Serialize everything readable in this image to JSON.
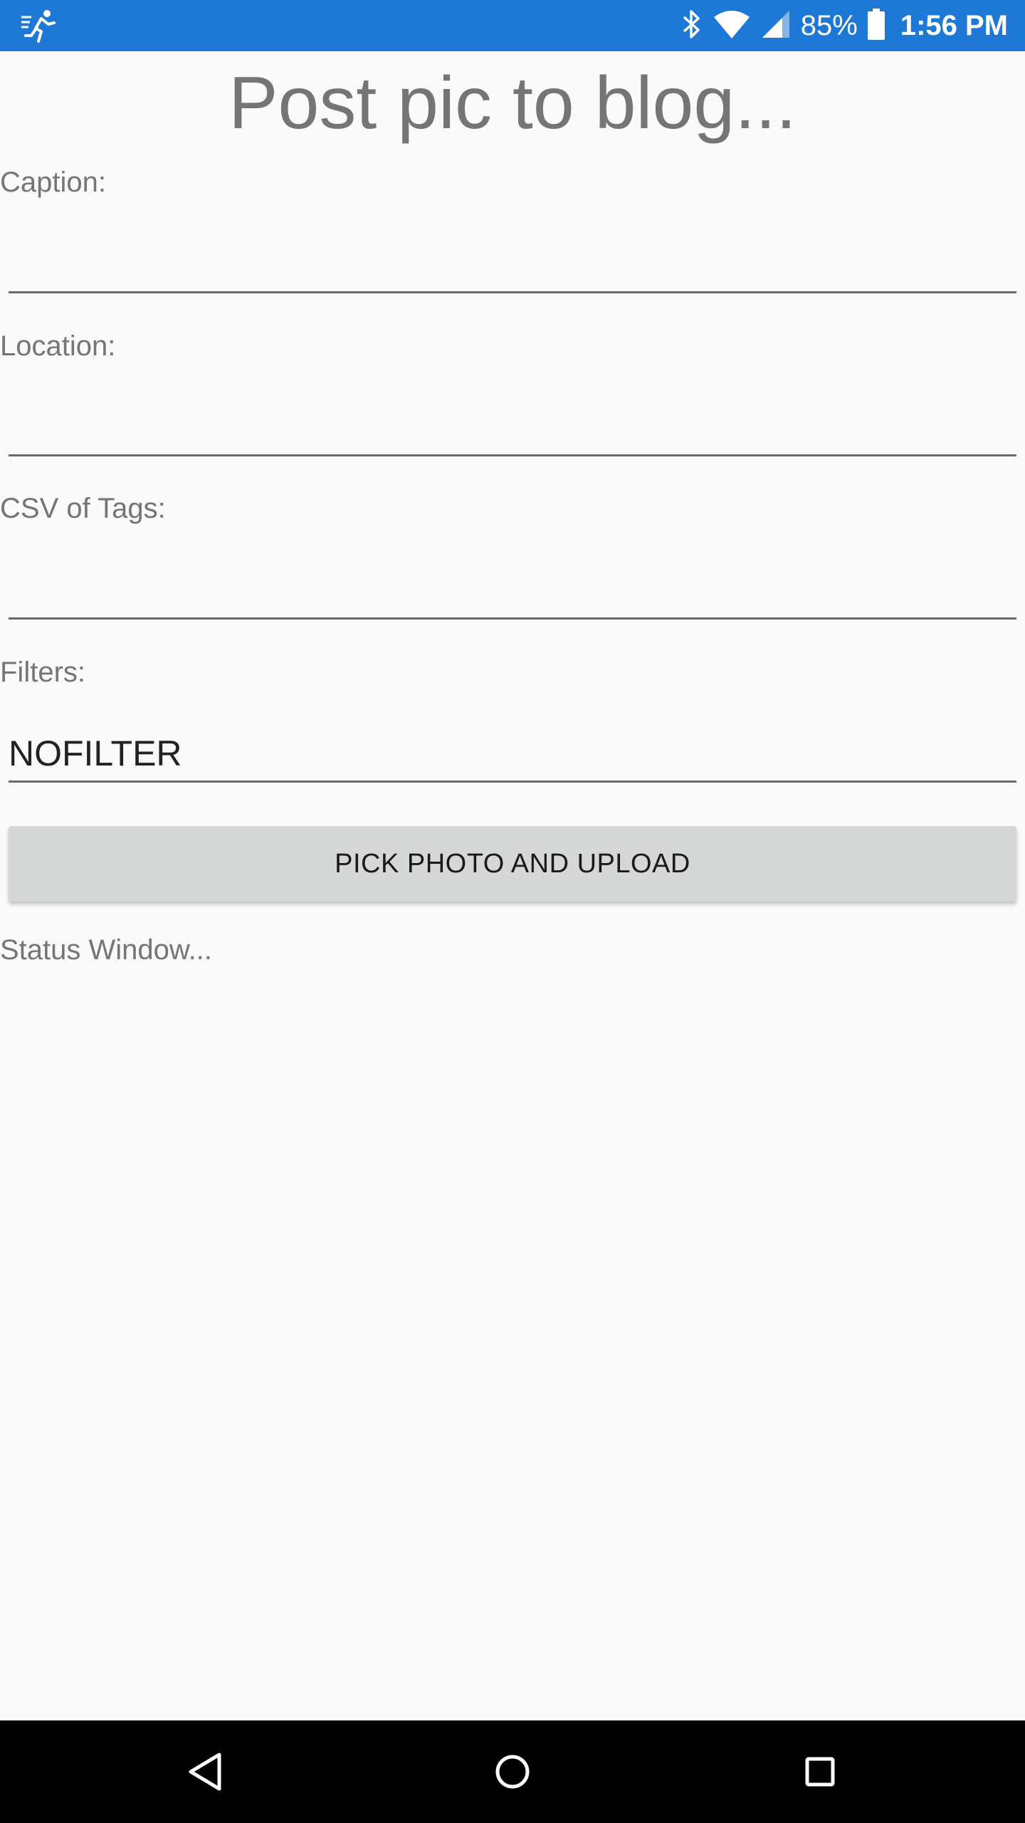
{
  "status_bar": {
    "battery_percent": "85%",
    "time": "1:56 PM",
    "icons": [
      "running-app-icon",
      "bluetooth-icon",
      "wifi-icon",
      "cell-signal-icon",
      "battery-icon"
    ],
    "background_color": "#1E78D6"
  },
  "page": {
    "title": "Post pic to blog..."
  },
  "form": {
    "caption": {
      "label": "Caption:",
      "value": ""
    },
    "location": {
      "label": "Location:",
      "value": ""
    },
    "tags": {
      "label": "CSV of Tags:",
      "value": ""
    },
    "filters": {
      "label": "Filters:",
      "value": "NOFILTER"
    }
  },
  "actions": {
    "pick_upload_label": "PICK PHOTO AND UPLOAD"
  },
  "status": {
    "text": "Status Window..."
  },
  "nav_bar": {
    "buttons": [
      "back-icon",
      "home-icon",
      "recents-icon"
    ]
  }
}
